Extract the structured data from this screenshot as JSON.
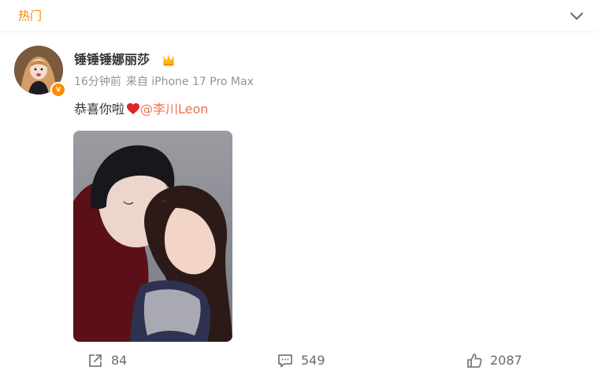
{
  "header": {
    "tab_label": "热门"
  },
  "post": {
    "username": "锤锤锤娜丽莎",
    "verified_badge": "v",
    "timestamp": "16分钟前",
    "source": "来自 iPhone 17 Pro Max",
    "text": "恭喜你啦",
    "mention": "@李川Leon"
  },
  "actions": {
    "repost_count": "84",
    "comment_count": "549",
    "like_count": "2087"
  },
  "colors": {
    "accent": "#ff8200",
    "mention": "#eb7350",
    "meta": "#939393"
  }
}
